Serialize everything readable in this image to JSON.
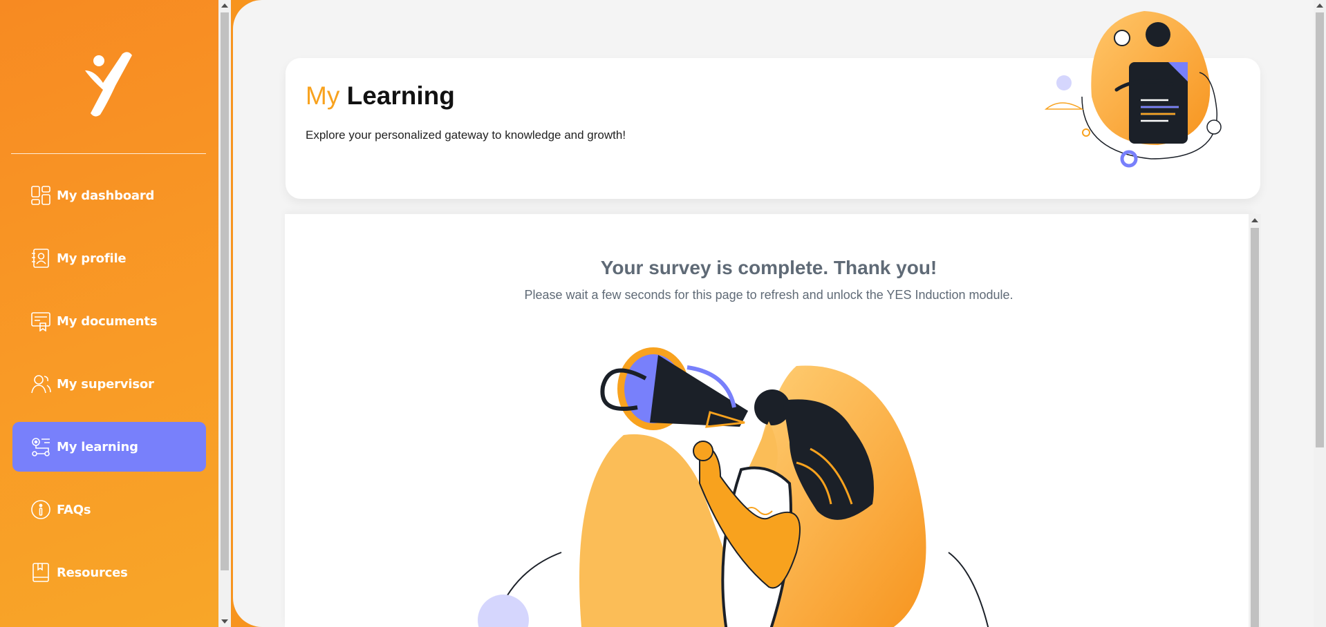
{
  "nav": {
    "items": [
      {
        "label": "My dashboard",
        "icon": "dashboard-grid-icon",
        "active": false
      },
      {
        "label": "My profile",
        "icon": "profile-card-icon",
        "active": false
      },
      {
        "label": "My documents",
        "icon": "documents-icon",
        "active": false
      },
      {
        "label": "My supervisor",
        "icon": "supervisor-people-icon",
        "active": false
      },
      {
        "label": "My learning",
        "icon": "learning-path-icon",
        "active": true
      },
      {
        "label": "FAQs",
        "icon": "info-circle-icon",
        "active": false
      },
      {
        "label": "Resources",
        "icon": "book-icon",
        "active": false
      }
    ]
  },
  "header": {
    "title_accent": "My",
    "title_main": "Learning",
    "subtitle": "Explore your personalized gateway to knowledge and growth!"
  },
  "survey": {
    "title": "Your survey is complete. Thank you!",
    "message": "Please wait a few seconds for this page to refresh and unlock the YES Induction module."
  },
  "colors": {
    "brand_orange": "#f7941e",
    "accent_yellow": "#f8a21e",
    "active_purple": "#7880fb",
    "text_gray": "#5f6a76",
    "ink": "#1b2028"
  }
}
